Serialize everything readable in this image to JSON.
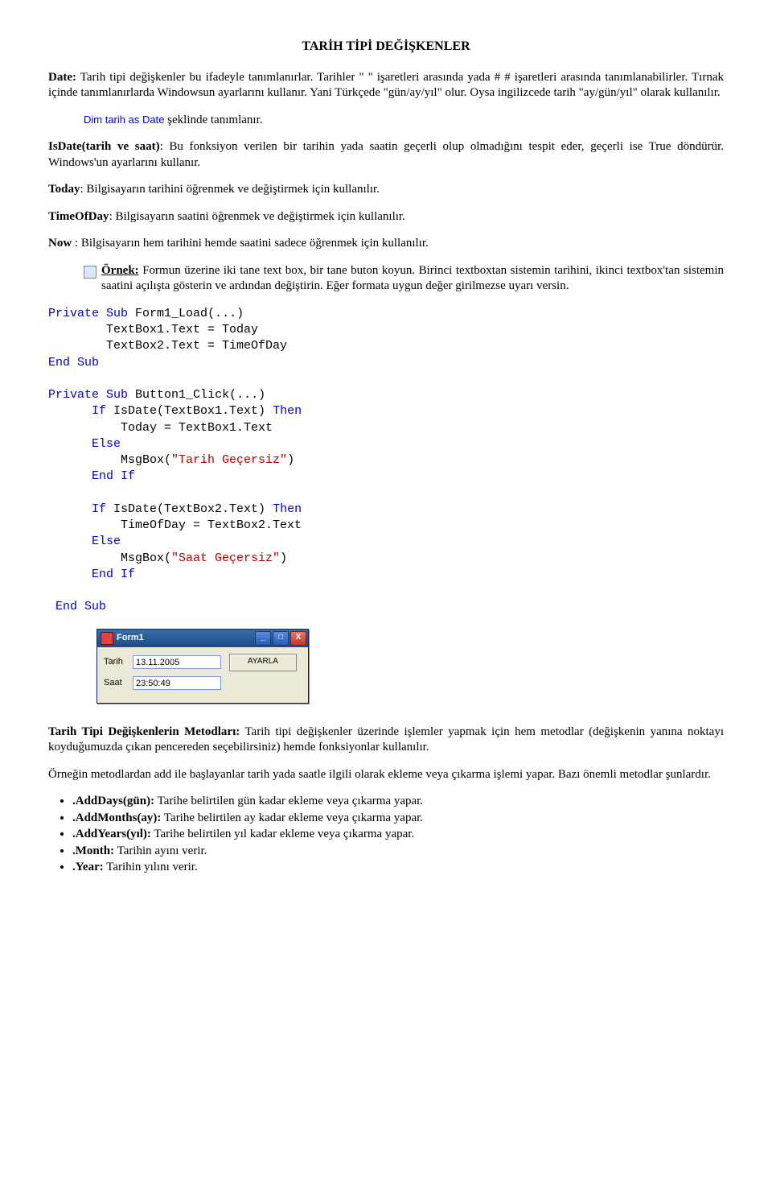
{
  "title": "TARİH TİPİ DEĞİŞKENLER",
  "para_date": "Date: Tarih tipi değişkenler bu ifadeyle tanımlanırlar. Tarihler \" \" işaretleri arasında yada # # işaretleri arasında tanımlanabilirler. Tırnak içinde tanımlanırlarda Windowsun ayarlarını kullanır. Yani Türkçede \"gün/ay/yıl\" olur. Oysa ingilizcede tarih \"ay/gün/yıl\" olarak kullanılır.",
  "dim_line_prefix": "Dim tarih as Date",
  "dim_line_suffix": " şeklinde tanımlanır.",
  "isdate_label": "IsDate(tarih ve saat)",
  "isdate_body": ": Bu fonksiyon verilen bir tarihin yada saatin geçerli olup olmadığını tespit eder, geçerli ise True döndürür. Windows'un ayarlarını kullanır.",
  "today_label": "Today",
  "today_body": ": Bilgisayarın tarihini öğrenmek ve değiştirmek için kullanılır.",
  "timeofday_label": "TimeOfDay",
  "timeofday_body": ": Bilgisayarın saatini öğrenmek ve değiştirmek için kullanılır.",
  "now_label": "Now ",
  "now_body": ": Bilgisayarın hem tarihini hemde saatini sadece öğrenmek için kullanılır.",
  "ornek_label": "Örnek:",
  "ornek_body": " Formun üzerine iki tane text box, bir tane buton koyun. Birinci textboxtan sistemin tarihini, ikinci  textbox'tan sistemin saatini açılışta gösterin ve ardından değiştirin. Eğer formata uygun değer girilmezse uyarı versin.",
  "code1_l1a": "Private",
  "code1_l1b": "Sub",
  "code1_l1c": " Form1_Load(...)",
  "code1_l2": "        TextBox1.Text = Today",
  "code1_l3": "        TextBox2.Text = TimeOfDay",
  "code1_l4a": "End",
  "code1_l4b": "Sub",
  "code2_l1a": "Private",
  "code2_l1b": "Sub",
  "code2_l1c": " Button1_Click(...)",
  "code2_l2a": "If",
  "code2_l2b": " IsDate(TextBox1.Text) ",
  "code2_l2c": "Then",
  "code2_l3": "          Today = TextBox1.Text",
  "code2_l4": "Else",
  "code2_l5a": "          MsgBox(",
  "code2_l5b": "\"Tarih Geçersiz\"",
  "code2_l5c": ")",
  "code2_l6a": "End",
  "code2_l6b": "If",
  "code2_l7a": "If",
  "code2_l7b": " IsDate(TextBox2.Text) ",
  "code2_l7c": "Then",
  "code2_l8": "          TimeOfDay = TextBox2.Text",
  "code2_l9": "Else",
  "code2_l10a": "          MsgBox(",
  "code2_l10b": "\"Saat Geçersiz\"",
  "code2_l10c": ")",
  "code2_l11a": "End",
  "code2_l11b": "If",
  "code2_end1": "End",
  "code2_end2": "Sub",
  "form": {
    "title": "Form1",
    "min": "_",
    "max": "□",
    "close": "X",
    "lbl_tarih": "Tarih",
    "lbl_saat": "Saat",
    "val_tarih": "13.11.2005",
    "val_saat": "23:50:49",
    "btn": "AYARLA"
  },
  "methods_heading_bold": "Tarih Tipi Değişkenlerin Metodları:",
  "methods_heading_rest": " Tarih tipi değişkenler üzerinde işlemler yapmak için hem metodlar (değişkenin yanına noktayı koyduğumuzda çıkan pencereden seçebilirsiniz) hemde fonksiyonlar kullanılır.",
  "methods_para2": "Örneğin metodlardan add ile başlayanlar tarih yada saatle ilgili olarak ekleme veya çıkarma işlemi yapar. Bazı önemli metodlar şunlardır.",
  "m1b": ".AddDays(gün):",
  "m1": " Tarihe belirtilen gün kadar ekleme veya çıkarma yapar.",
  "m2b": ".AddMonths(ay):",
  "m2": " Tarihe belirtilen ay kadar ekleme veya çıkarma yapar.",
  "m3b": ".AddYears(yıl):",
  "m3": " Tarihe belirtilen yıl kadar ekleme veya çıkarma yapar.",
  "m4b": ".Month:",
  "m4": " Tarihin ayını verir.",
  "m5b": ".Year:",
  "m5": " Tarihin yılını verir."
}
